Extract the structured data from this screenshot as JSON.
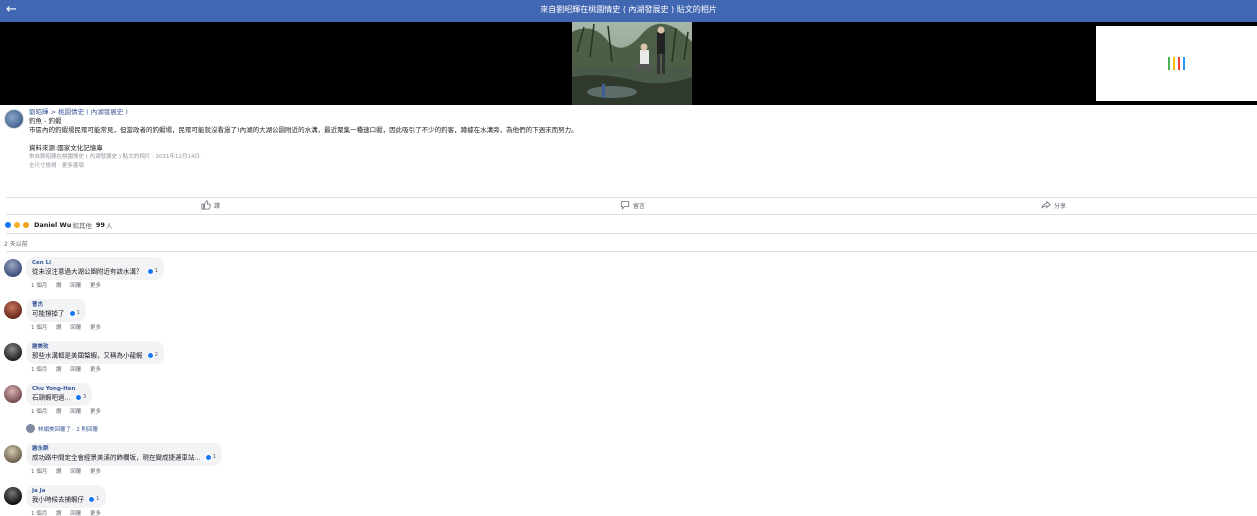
{
  "topbar": {
    "back_label": "←",
    "title": "來自劉昭輝在桃園情史 ( 內湖發展史 ) 貼文的相片"
  },
  "ad": {
    "colors": [
      "#4caf50",
      "#ffc107",
      "#f44336",
      "#2196f3"
    ]
  },
  "post": {
    "author_line": "劉昭輝 > 桃園情史 ( 內湖發展史 )",
    "lines": [
      "釣魚 - 釣蝦",
      "市區內的釣蝦場民眾可能常見，但當政者的釣蝦場，民眾可能就沒看過了!內湖的大湖公園附近的水溝，最近聚集一種速口蝦，因此吸引了不少的釣客，蹲據在水溝旁，為他們的下週末而努力。"
    ],
    "source": "資料來源:國家文化記憶庫",
    "meta": "來自劉昭輝在桃園情史 ( 內湖發展史 ) 貼文的相片 · 2021年12月14日 · ",
    "options": "全尺寸檢視 · 更多選項"
  },
  "actions": {
    "like": "讚",
    "comment": "留言",
    "share": "分享"
  },
  "reactions": {
    "name": "Daniel Wu",
    "suffix": "和其他",
    "count": "99",
    "unit": "人"
  },
  "time_ago": "2 天以前",
  "comment_actions": {
    "time": "1 個月",
    "like": "讚",
    "reply": "回覆",
    "more": "更多"
  },
  "comments": [
    {
      "name": "Cen Li",
      "text": "從未沒注意過大湖公園附近有該水溝？",
      "likes": "1"
    },
    {
      "name": "曹杰",
      "text": "可能撐掉了",
      "likes": "1"
    },
    {
      "name": "謝美玫",
      "text": "那些水溝都是美國螯蝦，又稱為小龍蝦",
      "likes": "2"
    },
    {
      "name": "Chu Yong-Hen",
      "text": "石頭蝦吧過...",
      "likes": "3"
    },
    {
      "name": "謝永群",
      "text": "成功路中間定全會經景美溪的飾欄坂，現在變成捷運車站...",
      "likes": "1"
    },
    {
      "name": "Ja Ja",
      "text": "我小時候去捕蝦仔",
      "likes": "1"
    }
  ],
  "reply_line": {
    "text": "林娟美回覆了 · 2 則回覆",
    "time": ""
  }
}
